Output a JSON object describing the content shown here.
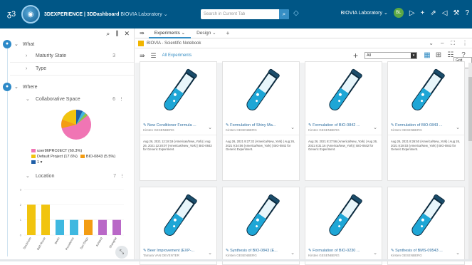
{
  "header": {
    "app_title": "3DEXPERIENCE | 3DDashboard",
    "app_subtitle": "BIOVIA Laboratory ⌄",
    "search_placeholder": "Search in Current Tab",
    "tenant": "BIOVIA Laboratory ⌄",
    "avatar_initials": "BL"
  },
  "sidebar": {
    "what_label": "What",
    "maturity_label": "Maturity State",
    "maturity_count": "3",
    "type_label": "Type",
    "where_label": "Where",
    "collab_label": "Collaborative Space",
    "collab_count": "6",
    "legend": [
      {
        "label": "user86PROJECT (60.3%)",
        "color": "#f075b4"
      },
      {
        "label": "Default Project (17.6%)",
        "color": "#f1c40f"
      },
      {
        "label": "BIO-0843 (5.5%)",
        "color": "#f39c12"
      },
      {
        "label": "1 ▾",
        "color": "#1f5fa8"
      }
    ],
    "location_label": "Location",
    "location_count": "7",
    "location_chart_data": {
      "type": "bar",
      "categories": [
        "Stockholm",
        "Bath Route",
        "Berlin",
        "Providence",
        "San Diego",
        "Ashland",
        "Shanghai"
      ],
      "values": [
        2,
        2,
        1,
        1,
        1,
        1,
        1
      ],
      "ylim": [
        0,
        3
      ],
      "colors": [
        "#f1c40f",
        "#f1c40f",
        "#3fb8e0",
        "#3fb8e0",
        "#f39c12",
        "#b968c7",
        "#b968c7"
      ]
    }
  },
  "tabs": [
    {
      "label": "Experiments"
    },
    {
      "label": "Design"
    }
  ],
  "notebook": {
    "title": "BIOVIA - Scientific Notebook"
  },
  "toolbar": {
    "link": "All Experiments",
    "select_value": "All",
    "tooltip": "Grid View"
  },
  "cards": [
    {
      "title": "New Conditioner Formula ...",
      "owner": "Kirsten GESENBERG",
      "desc": "Aug 26, 2021 12:18:19 (Americas/New_York) | Aug 26, 2021 12:20:07 (Americas/New_York) | BIO-0843 for Generic Experiment."
    },
    {
      "title": "Formulation of Shiny Ma...",
      "owner": "Kirsten GESENBERG",
      "desc": "Aug 26, 2021 9:27:32 (America/New_York) | Aug 26, 2021 9:34:06 (America/New_York) | BIO-0842 for Generic Experiment."
    },
    {
      "title": "Formulation of BIO-0842 ...",
      "owner": "Kirsten GESENBERG",
      "desc": "Aug 26, 2021 8:27:56 (America/New_York) | Aug 26, 2021 8:31:16 (America/New_York) | BIO-0842 for Generic Experiment."
    },
    {
      "title": "Formulation of BIO-0843 ...",
      "owner": "Kirsten GESENBERG",
      "desc": "Aug 26, 2021 8:26:50 (America/New_York) | Aug 26, 2021 8:28:03 (America/New_York) | BIO-0843 for Generic Experiment."
    },
    {
      "title": "Beer Improvement (EXP-...",
      "owner": "Tamara VAN DEVENTER",
      "desc": ""
    },
    {
      "title": "Synthesis of BIO-0843 (E...",
      "owner": "Kirsten GESENBERG",
      "desc": ""
    },
    {
      "title": "Formulation of BIO-0230 ...",
      "owner": "Kirsten GESENBERG",
      "desc": ""
    },
    {
      "title": "Synthesis of BMS-09543 ...",
      "owner": "Kirsten GESENBERG",
      "desc": ""
    }
  ]
}
